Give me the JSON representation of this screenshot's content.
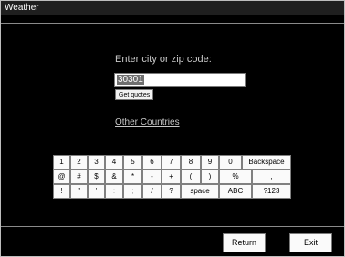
{
  "window": {
    "title": "Weather"
  },
  "search": {
    "prompt": "Enter city or zip code:",
    "value": "30301",
    "get_quotes_label": "Get quotes",
    "other_countries_link": "Other Countries"
  },
  "keyboard": {
    "rows": [
      [
        "1",
        "2",
        "3",
        "4",
        "5",
        "6",
        "7",
        "8",
        "9",
        "0",
        "Backspace"
      ],
      [
        "@",
        "#",
        "$",
        "&",
        "*",
        "-",
        "+",
        "(",
        ")",
        "%",
        ","
      ],
      [
        "!",
        "\"",
        "'",
        ":",
        ";",
        "/",
        "?",
        "space",
        "ABC",
        "?123"
      ]
    ]
  },
  "footer": {
    "return_label": "Return",
    "exit_label": "Exit"
  },
  "colors": {
    "background": "#000000",
    "text": "#c8c8c8",
    "key_bg": "#fafafa"
  }
}
